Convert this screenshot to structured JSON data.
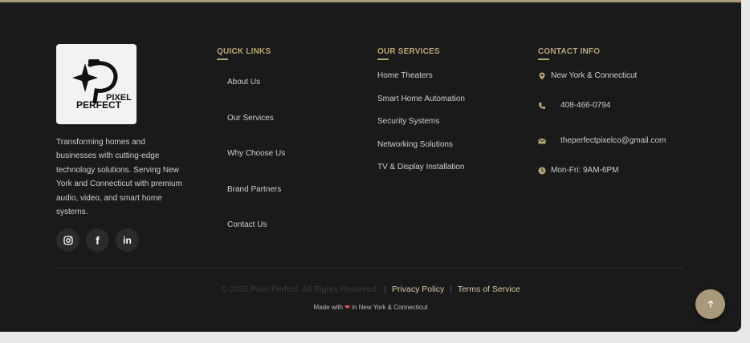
{
  "brand": {
    "logo_text_line1": "PIXEL",
    "logo_text_line2": "PERFECT",
    "description": "Transforming homes and businesses with cutting-edge technology solutions. Serving New York and Connecticut with premium audio, video, and smart home systems.",
    "social": [
      {
        "name": "instagram-icon"
      },
      {
        "name": "facebook-icon",
        "glyph": "f"
      },
      {
        "name": "linkedin-icon",
        "glyph": "in"
      }
    ]
  },
  "quick_links": {
    "title": "QUICK LINKS",
    "items": [
      "About Us",
      "Our Services",
      "Why Choose Us",
      "Brand Partners",
      "Contact Us"
    ]
  },
  "services": {
    "title": "OUR SERVICES",
    "items": [
      "Home Theaters",
      "Smart Home Automation",
      "Security Systems",
      "Networking Solutions",
      "TV & Display Installation"
    ]
  },
  "contact": {
    "title": "CONTACT INFO",
    "location": "New York & Connecticut",
    "phone": "408-466-0794",
    "email": "theperfectpixelco@gmail.com",
    "hours": "Mon-Fri: 9AM-6PM"
  },
  "bottom": {
    "copyright": "© 2025 Pixel Perfect. All Rights Reserved.",
    "separator": "|",
    "privacy": "Privacy Policy",
    "terms": "Terms of Service",
    "made_prefix": "Made with",
    "made_suffix": "in New York & Connecticut"
  },
  "colors": {
    "background": "#1a1a1a",
    "accent": "#b7a57a",
    "heart": "#e0505a"
  }
}
